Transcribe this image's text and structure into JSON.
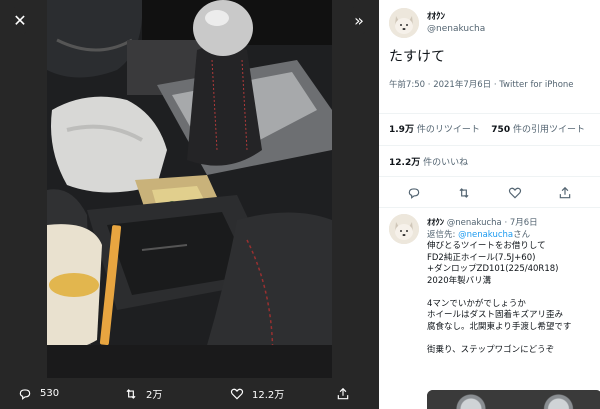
{
  "viewer": {
    "close_icon": "close-icon",
    "expand_icon": "expand-icon",
    "actions": {
      "reply_count": "530",
      "retweet_count": "2万",
      "like_count": "12.2万"
    }
  },
  "tweet": {
    "name": "ｵｵｸﾝ",
    "handle": "@nenakucha",
    "text": "たすけて",
    "meta": "午前7:50 · 2021年7月6日 · Twitter for iPhone",
    "retweets_value": "1.9万",
    "retweets_label": "件のリツイート",
    "quotes_value": "750",
    "quotes_label": "件の引用ツイート",
    "likes_value": "12.2万",
    "likes_label": "件のいいね"
  },
  "reply": {
    "name": "ｵｵｸﾝ",
    "handle": "@nenakucha",
    "date": "· 7月6日",
    "replying_prefix": "返信先:",
    "replying_to": "@nenakucha",
    "replying_suffix": "さん",
    "lines": [
      "伸びとるツイートをお借りして",
      "FD2純正ホイール(7.5J+60)",
      "+ダンロップZD101(225/40R18)",
      "2020年製バリ溝",
      "",
      "4マンでいかがでしょうか",
      "ホイールはダスト固着キズアリ歪み",
      "腐食なし。北関東より手渡し希望です",
      "",
      "街乗り、ステップワゴンにどうぞ"
    ]
  },
  "colors": {
    "viewer_bg": "#272727",
    "link": "#1d9bf0",
    "muted": "#536471",
    "text": "#0f1419"
  }
}
